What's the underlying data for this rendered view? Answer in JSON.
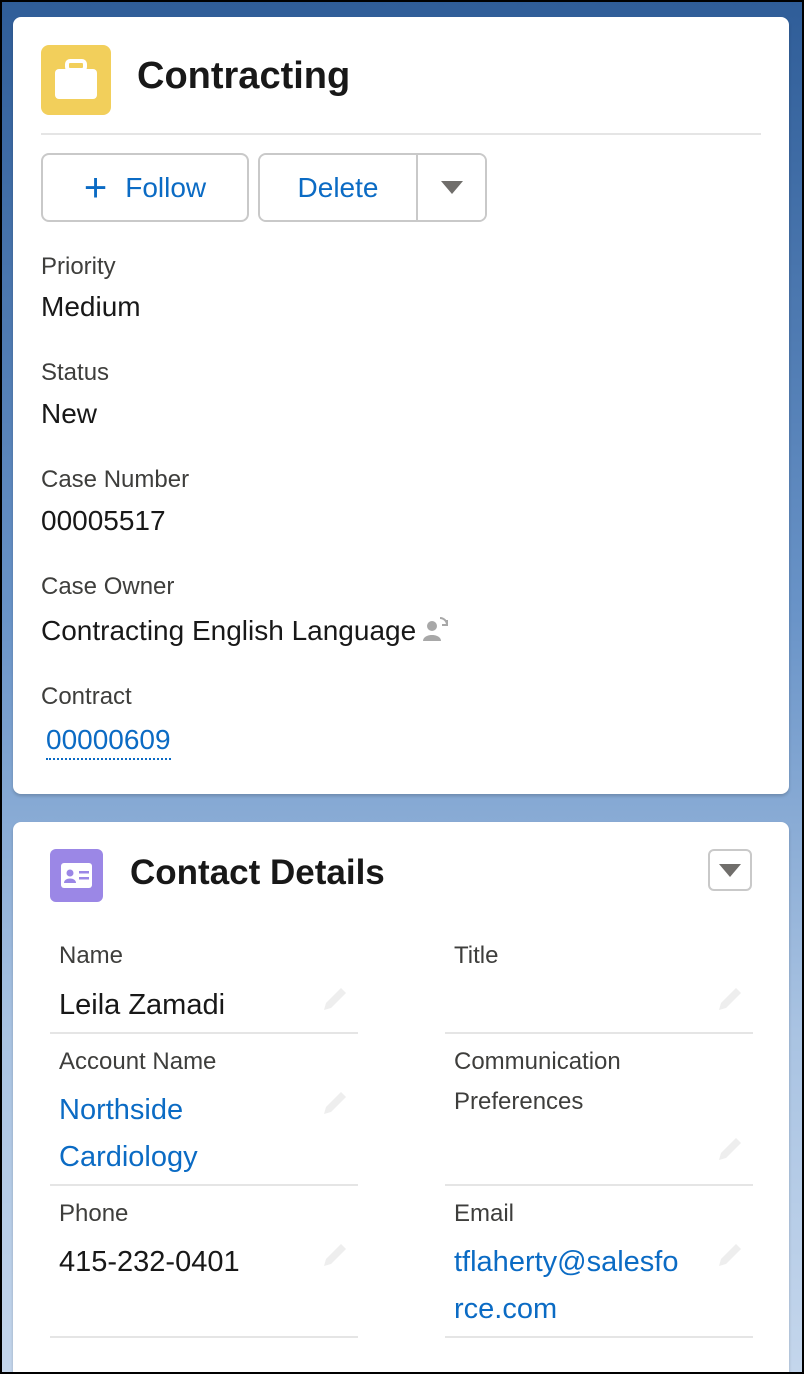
{
  "record": {
    "title": "Contracting",
    "icon": "briefcase-icon",
    "icon_color": "#f2cf5b"
  },
  "actions": {
    "follow_label": "Follow",
    "delete_label": "Delete"
  },
  "fields": {
    "priority": {
      "label": "Priority",
      "value": "Medium"
    },
    "status": {
      "label": "Status",
      "value": "New"
    },
    "case_number": {
      "label": "Case Number",
      "value": "00005517"
    },
    "case_owner": {
      "label": "Case Owner",
      "value": "Contracting English Language"
    },
    "contract": {
      "label": "Contract",
      "value": "00000609"
    }
  },
  "contact": {
    "title": "Contact Details",
    "icon": "contact-card-icon",
    "icon_color": "#9b87e6",
    "name": {
      "label": "Name",
      "value": "Leila Zamadi"
    },
    "title_field": {
      "label": "Title",
      "value": ""
    },
    "account_name": {
      "label": "Account Name",
      "line1": "Northside",
      "line2": "Cardiology"
    },
    "communication_preferences": {
      "label_line1": "Communication",
      "label_line2": "Preferences",
      "value": ""
    },
    "phone": {
      "label": "Phone",
      "value": "415-232-0401"
    },
    "email": {
      "label": "Email",
      "line1": "tflaherty@salesfo",
      "line2": "rce.com"
    }
  },
  "colors": {
    "link": "#0b6bc4",
    "text": "#181818",
    "label": "#3e3e3c"
  }
}
